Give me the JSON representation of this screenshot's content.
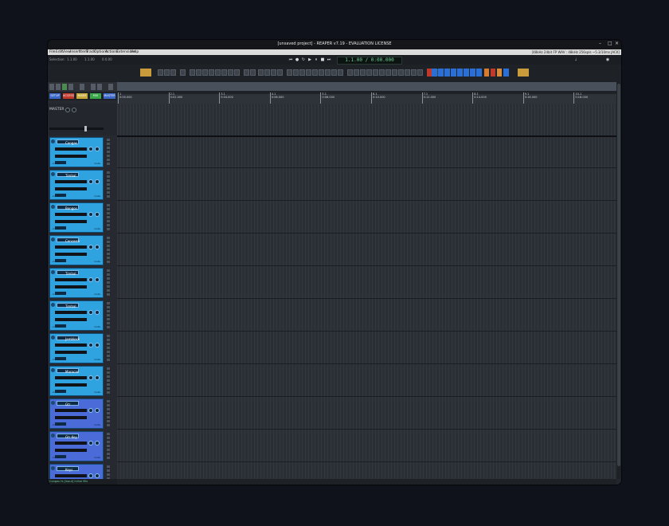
{
  "window": {
    "title": "[unsaved project] - REAPER v7.19 - EVALUATION LICENSE",
    "controls": [
      "–",
      "□",
      "×"
    ]
  },
  "menu": [
    "File",
    "Edit",
    "View",
    "Insert",
    "Item",
    "Track",
    "Options",
    "Actions",
    "Extensions",
    "Help"
  ],
  "status_right": "[48kHz 24bit FP WAV : 48kHz 256spls ~5.3/10ms JACK]",
  "transport": {
    "selection_label": "Selection:",
    "sel_start": "1.1.00",
    "sel_end": "1.1.00",
    "sel_len": "0.0.00",
    "clock": "1.1.00 / 0:00.000"
  },
  "tcp_buttons": [
    {
      "label": "SETUP",
      "color": "#3b67c6"
    },
    {
      "label": "ACCESS",
      "color": "#c0392b"
    },
    {
      "label": "MIXER",
      "color": "#c7a83a"
    },
    {
      "label": "MIX",
      "color": "#3aa64a"
    },
    {
      "label": "MASTER",
      "color": "#3b67c6"
    }
  ],
  "master": {
    "label": "MASTER"
  },
  "tracks": [
    {
      "name": "Congas",
      "color": "#2fa3e0"
    },
    {
      "name": "Timbal",
      "color": "#2fa3e0"
    },
    {
      "name": "Bongos",
      "color": "#2fa3e0"
    },
    {
      "name": "Cencerro",
      "color": "#2fa3e0"
    },
    {
      "name": "Timbal",
      "color": "#2fa3e0"
    },
    {
      "name": "Timbal",
      "color": "#2fa3e0"
    },
    {
      "name": "Jamblock",
      "color": "#2fa3e0"
    },
    {
      "name": "Maracas",
      "color": "#2fa3e0"
    },
    {
      "name": "Gtr",
      "color": "#4b6bd8"
    },
    {
      "name": "Gtr Key",
      "color": "#4b6bd8"
    },
    {
      "name": "Keys",
      "color": "#4b6bd8"
    }
  ],
  "track_labels": {
    "vol": "-inf dB",
    "route": "route"
  },
  "ruler": {
    "bars": [
      {
        "bar": "1",
        "time": "0:00.000"
      },
      {
        "bar": "2.1",
        "time": "0:02.000"
      },
      {
        "bar": "3.1",
        "time": "0:04.000"
      },
      {
        "bar": "4.1",
        "time": "0:06.000"
      },
      {
        "bar": "5.1",
        "time": "0:08.000"
      },
      {
        "bar": "6.1",
        "time": "0:10.000"
      },
      {
        "bar": "7.1",
        "time": "0:12.000"
      },
      {
        "bar": "8.1",
        "time": "0:14.000"
      },
      {
        "bar": "9.1",
        "time": "0:16.000"
      },
      {
        "bar": "10.1",
        "time": "0:18.000"
      }
    ]
  },
  "statusbar": "Congas fx [Input] Inline Mix",
  "icons": [
    "record-icon",
    "play-icon",
    "stop-icon",
    "pause-icon",
    "loop-icon",
    "rewind-icon",
    "forward-icon"
  ]
}
